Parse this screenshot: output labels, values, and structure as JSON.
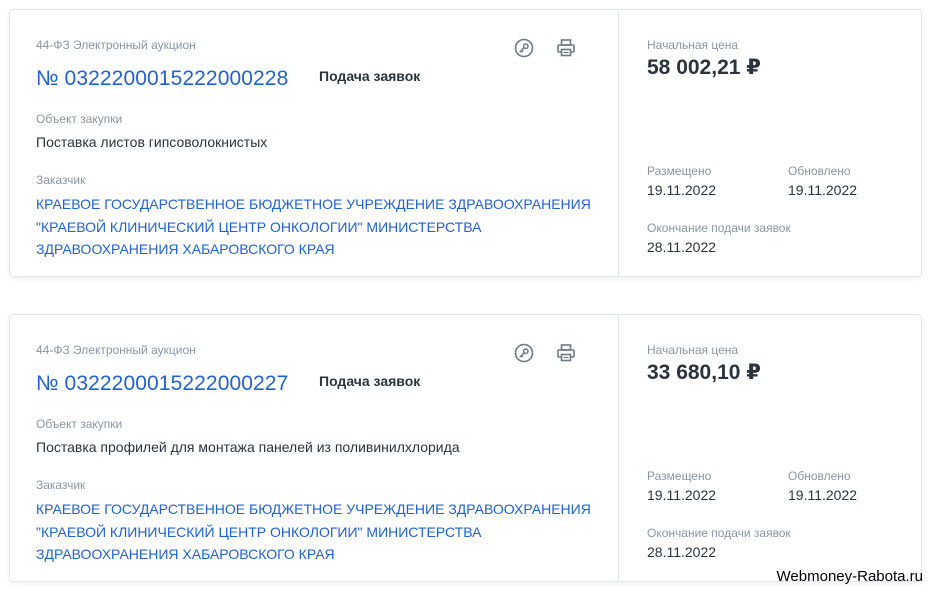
{
  "colors": {
    "link": "#1f62d6",
    "text": "#2b333c",
    "muted": "#8a96a3",
    "border": "#e3e6ea"
  },
  "icons": [
    "key-icon",
    "printer-icon"
  ],
  "cards": [
    {
      "law": "44-ФЗ Электронный аукцион",
      "number": "№ 0322200015222000228",
      "stage": "Подача заявок",
      "object_label": "Объект закупки",
      "object": "Поставка листов гипсоволокнистых",
      "customer_label": "Заказчик",
      "customer": "КРАЕВОЕ ГОСУДАРСТВЕННОЕ БЮДЖЕТНОЕ УЧРЕЖДЕНИЕ ЗДРАВООХРАНЕНИЯ \"КРАЕВОЙ КЛИНИЧЕСКИЙ ЦЕНТР ОНКОЛОГИИ\" МИНИСТЕРСТВА ЗДРАВООХРАНЕНИЯ ХАБАРОВСКОГО КРАЯ",
      "price_label": "Начальная цена",
      "price": "58 002,21 ₽",
      "placed_label": "Размещено",
      "placed": "19.11.2022",
      "updated_label": "Обновлено",
      "updated": "19.11.2022",
      "end_label": "Окончание подачи заявок",
      "end": "28.11.2022"
    },
    {
      "law": "44-ФЗ Электронный аукцион",
      "number": "№ 0322200015222000227",
      "stage": "Подача заявок",
      "object_label": "Объект закупки",
      "object": "Поставка профилей для монтажа панелей из поливинилхлорида",
      "customer_label": "Заказчик",
      "customer": "КРАЕВОЕ ГОСУДАРСТВЕННОЕ БЮДЖЕТНОЕ УЧРЕЖДЕНИЕ ЗДРАВООХРАНЕНИЯ \"КРАЕВОЙ КЛИНИЧЕСКИЙ ЦЕНТР ОНКОЛОГИИ\" МИНИСТЕРСТВА ЗДРАВООХРАНЕНИЯ ХАБАРОВСКОГО КРАЯ",
      "price_label": "Начальная цена",
      "price": "33 680,10 ₽",
      "placed_label": "Размещено",
      "placed": "19.11.2022",
      "updated_label": "Обновлено",
      "updated": "19.11.2022",
      "end_label": "Окончание подачи заявок",
      "end": "28.11.2022"
    }
  ],
  "watermark": "Webmoney-Rabota.ru"
}
